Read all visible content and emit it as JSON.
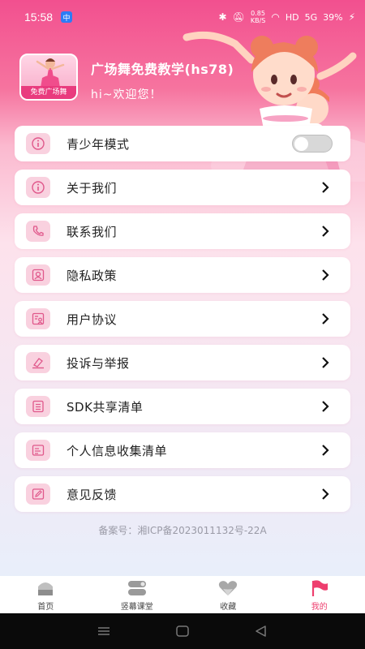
{
  "status_bar": {
    "time": "15:58",
    "app_badge": "中",
    "speed_value": "0.85",
    "speed_unit": "KB/S",
    "hd": "HD",
    "network": "5G",
    "battery": "39%"
  },
  "header": {
    "logo_caption": "免费广场舞",
    "title": "广场舞免费教学(hs78)",
    "greeting": "hi~欢迎您！"
  },
  "menu": {
    "items": [
      {
        "label": "青少年模式",
        "icon": "info-icon",
        "control": "toggle",
        "toggle_on": false
      },
      {
        "label": "关于我们",
        "icon": "info-icon",
        "control": "chevron"
      },
      {
        "label": "联系我们",
        "icon": "phone-icon",
        "control": "chevron"
      },
      {
        "label": "隐私政策",
        "icon": "privacy-icon",
        "control": "chevron"
      },
      {
        "label": "用户协议",
        "icon": "user-agreement-icon",
        "control": "chevron"
      },
      {
        "label": "投诉与举报",
        "icon": "complaint-icon",
        "control": "chevron"
      },
      {
        "label": "SDK共享清单",
        "icon": "list-icon",
        "control": "chevron"
      },
      {
        "label": "个人信息收集清单",
        "icon": "document-icon",
        "control": "chevron"
      },
      {
        "label": "意见反馈",
        "icon": "edit-icon",
        "control": "chevron"
      }
    ]
  },
  "icp": "备案号：湘ICP备2023011132号-22A",
  "tabs": [
    {
      "label": "首页",
      "icon": "home-icon",
      "active": false
    },
    {
      "label": "竖幕课堂",
      "icon": "video-class-icon",
      "active": false
    },
    {
      "label": "收藏",
      "icon": "heart-icon",
      "active": false
    },
    {
      "label": "我的",
      "icon": "flag-icon",
      "active": true
    }
  ],
  "colors": {
    "brand_pink": "#f2508f",
    "icon_bg": "#f9d1df",
    "icon_stroke": "#e0588b",
    "active_tab": "#ee3e6e"
  }
}
